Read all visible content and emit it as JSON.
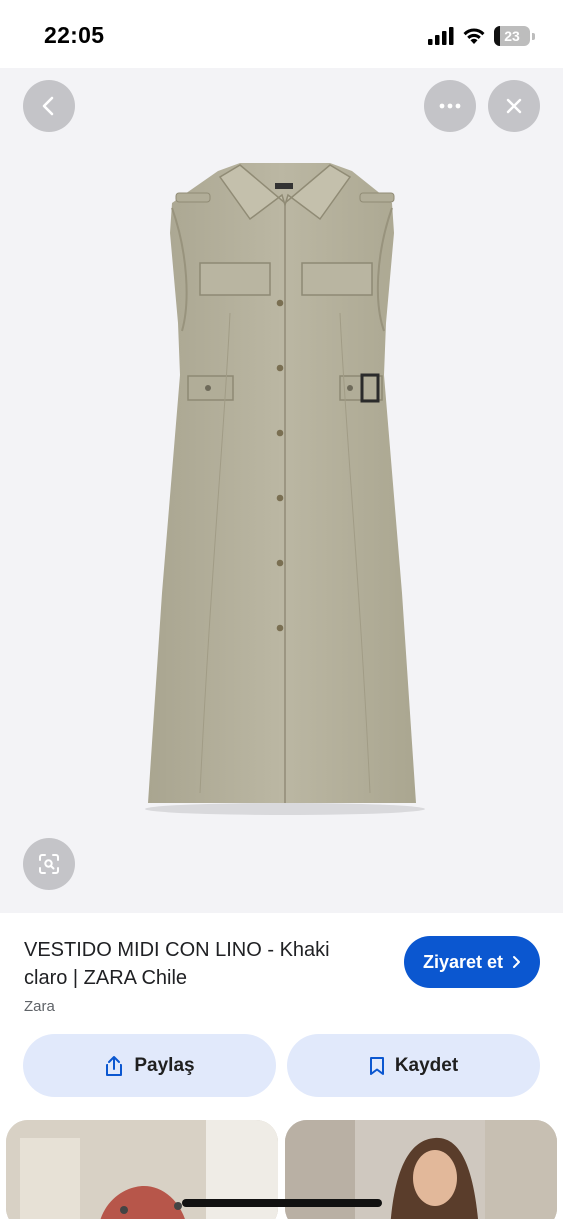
{
  "status_bar": {
    "time": "22:05",
    "battery": "23"
  },
  "viewer": {
    "back_icon": "chevron-left-icon",
    "more_icon": "more-horizontal-icon",
    "close_icon": "close-icon",
    "lens_icon": "lens-search-icon",
    "image_alt": "khaki sleeveless shirt dress with belt"
  },
  "product": {
    "title": "VESTIDO MIDI CON LINO - Khaki claro | ZARA Chile",
    "source": "Zara",
    "visit_label": "Ziyaret et"
  },
  "actions": {
    "share_label": "Paylaş",
    "save_label": "Kaydet"
  },
  "colors": {
    "accent": "#0b57d0",
    "action_bg": "#e1e9fb",
    "viewer_bg": "#f3f3f6",
    "dress": "#b6b29f"
  }
}
